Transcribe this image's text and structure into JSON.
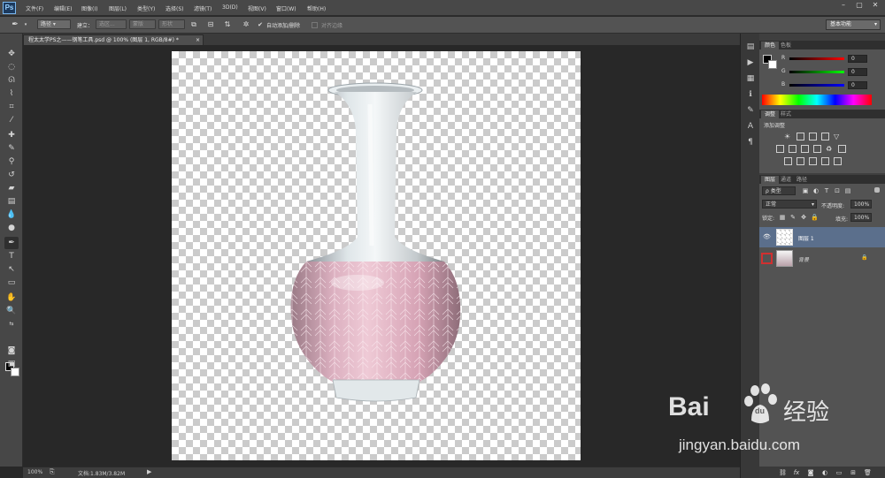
{
  "app": {
    "logo": "Ps"
  },
  "menu": [
    "文件(F)",
    "编辑(E)",
    "图像(I)",
    "图层(L)",
    "类型(Y)",
    "选择(S)",
    "滤镜(T)",
    "3D(D)",
    "视图(V)",
    "窗口(W)",
    "帮助(H)"
  ],
  "window_controls": [
    "–",
    "▢",
    "✕"
  ],
  "options": {
    "path_mode": "路径",
    "build_label": "建立：",
    "selection_btn": "选区...",
    "mask_btn": "蒙版",
    "shape_btn": "形状",
    "auto_add_delete": "自动添加/删除",
    "align_edges": "对齐边缘",
    "workspace": "基本功能"
  },
  "document": {
    "tab": "程太太学PS之——钢笔工具.psd @ 100% (图层 1, RGB/8#) *",
    "close": "×"
  },
  "status": {
    "zoom": "100%",
    "doc_info": "文档:1.83M/3.82M"
  },
  "color_panel": {
    "tabs": [
      "颜色",
      "色板"
    ],
    "channels": [
      {
        "label": "R",
        "value": "0"
      },
      {
        "label": "G",
        "value": "0"
      },
      {
        "label": "B",
        "value": "0"
      }
    ]
  },
  "adjust_panel": {
    "tabs": [
      "调整",
      "样式"
    ],
    "title": "添加调整"
  },
  "layers_panel": {
    "tabs": [
      "图层",
      "通道",
      "路径"
    ],
    "filter": "ρ 类型",
    "blend": "正常",
    "opacity_label": "不透明度:",
    "opacity": "100%",
    "lock_label": "锁定:",
    "fill_label": "填充:",
    "fill": "100%",
    "layers": [
      {
        "name": "图层 1",
        "selected": true,
        "visible": true
      },
      {
        "name": "背景",
        "selected": false,
        "visible": false,
        "locked": true
      }
    ]
  },
  "watermark": {
    "brand": "Bai",
    "brand2": "经验",
    "paw": "du",
    "url": "jingyan.baidu.com"
  },
  "colors": {
    "selected_layer": "#5b6f8c",
    "checker": "#cbcbcb",
    "accent": "#d03030"
  }
}
